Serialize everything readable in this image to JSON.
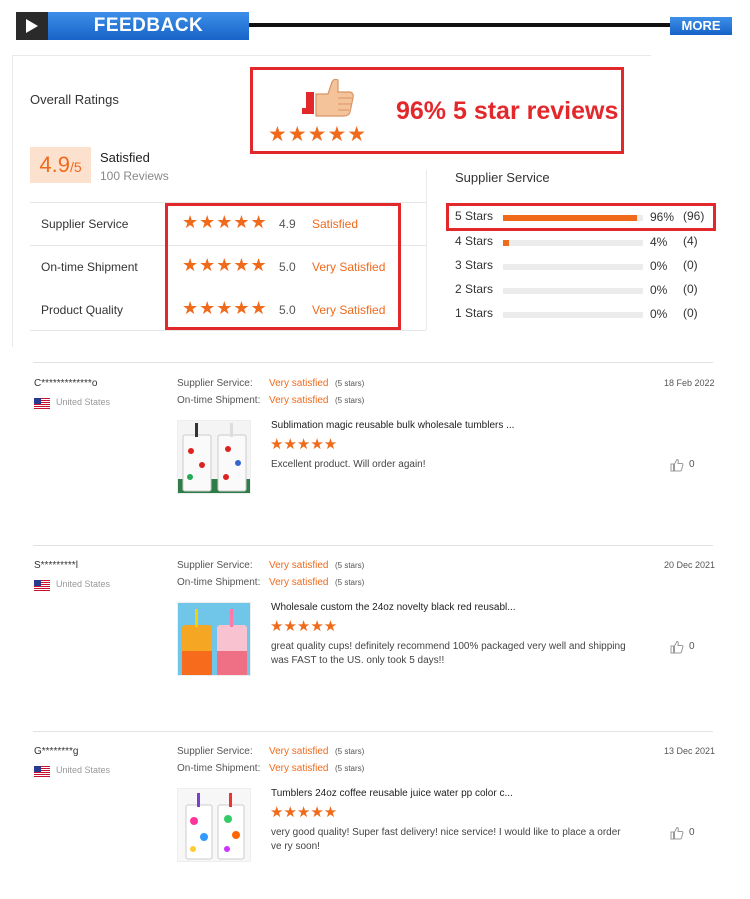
{
  "header": {
    "title": "FEEDBACK",
    "more_label": "MORE",
    "play_icon": "play-icon"
  },
  "summary": {
    "overall_label": "Overall Ratings",
    "score": "4.9",
    "score_max": "/5",
    "satisfaction": "Satisfied",
    "review_count": "100 Reviews",
    "categories": [
      {
        "name": "Supplier Service",
        "rating": 5,
        "score": "4.9",
        "status": "Satisfied"
      },
      {
        "name": "On-time Shipment",
        "rating": 5,
        "score": "5.0",
        "status": "Very Satisfied"
      },
      {
        "name": "Product Quality",
        "rating": 5,
        "score": "5.0",
        "status": "Very Satisfied"
      }
    ],
    "distribution_title": "Supplier Service",
    "distribution": [
      {
        "label": "5 Stars",
        "fraction": 0.96,
        "percent": "96%",
        "count": "(96)"
      },
      {
        "label": "4 Stars",
        "fraction": 0.04,
        "percent": "4%",
        "count": "(4)"
      },
      {
        "label": "3 Stars",
        "fraction": 0,
        "percent": "0%",
        "count": "(0)"
      },
      {
        "label": "2 Stars",
        "fraction": 0,
        "percent": "0%",
        "count": "(0)"
      },
      {
        "label": "1 Stars",
        "fraction": 0,
        "percent": "0%",
        "count": "(0)"
      }
    ]
  },
  "promo": {
    "text": "96% 5 star reviews",
    "rating": 5,
    "icon": "thumbs-up-icon"
  },
  "reviews": [
    {
      "reviewer": "C*************o",
      "country": "United States",
      "supplier_service_label": "Supplier Service:",
      "supplier_service_value": "Very satisfied",
      "supplier_service_stars": "(5 stars)",
      "shipment_label": "On-time Shipment:",
      "shipment_value": "Very satisfied",
      "shipment_stars": "(5 stars)",
      "date": "18 Feb 2022",
      "product_title": "Sublimation magic reusable bulk wholesale tumblers ...",
      "rating": 5,
      "text": "Excellent product. Will order again!",
      "likes": "0"
    },
    {
      "reviewer": "S*********l",
      "country": "United States",
      "supplier_service_label": "Supplier Service:",
      "supplier_service_value": "Very satisfied",
      "supplier_service_stars": "(5 stars)",
      "shipment_label": "On-time Shipment:",
      "shipment_value": "Very satisfied",
      "shipment_stars": "(5 stars)",
      "date": "20 Dec 2021",
      "product_title": "Wholesale custom the 24oz novelty black red reusabl...",
      "rating": 5,
      "text": "great quality cups! definitely recommend 100% packaged very well and shipping was FAST to the US. only took 5 days!!",
      "likes": "0"
    },
    {
      "reviewer": "G********g",
      "country": "United States",
      "supplier_service_label": "Supplier Service:",
      "supplier_service_value": "Very satisfied",
      "supplier_service_stars": "(5 stars)",
      "shipment_label": "On-time Shipment:",
      "shipment_value": "Very satisfied",
      "shipment_stars": "(5 stars)",
      "date": "13 Dec 2021",
      "product_title": "Tumblers 24oz coffee reusable juice water pp color c...",
      "rating": 5,
      "text": "very good quality! Super fast delivery! nice service! I would like to place a order ve ry soon!",
      "likes": "0"
    }
  ],
  "colors": {
    "accent": "#f06a1c",
    "highlight": "#e3282c",
    "header_blue": "#1f6fd6"
  }
}
